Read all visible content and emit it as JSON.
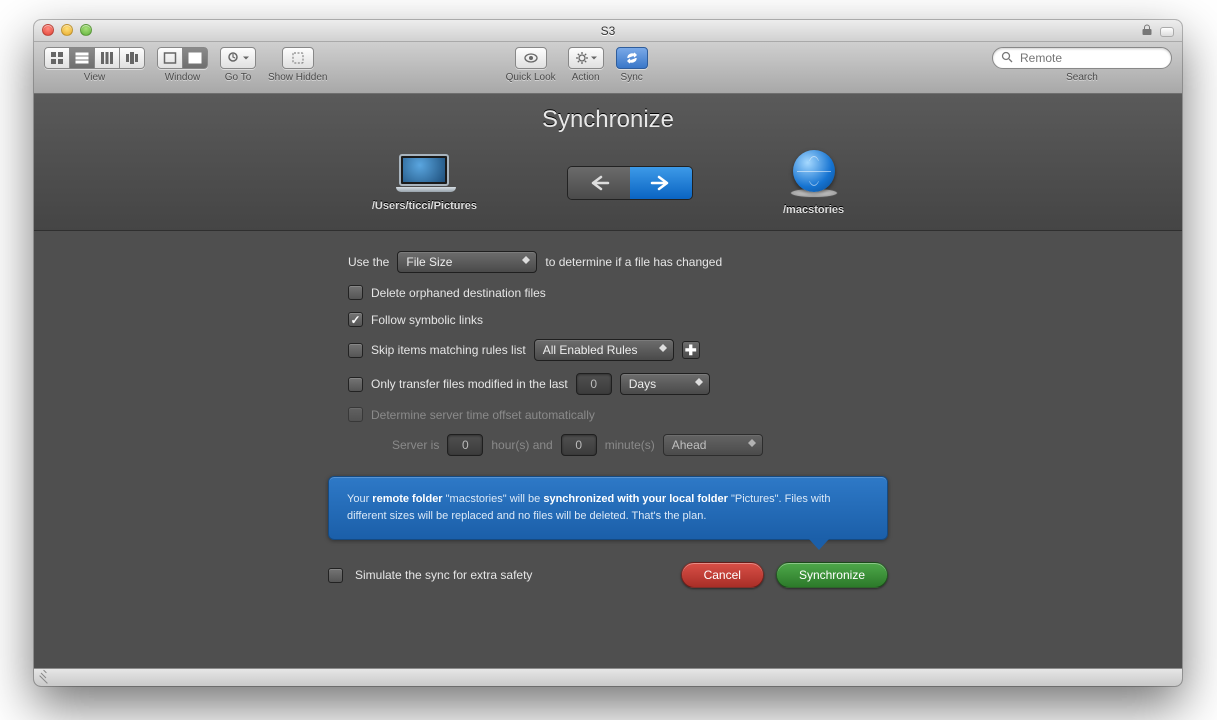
{
  "window": {
    "title": "S3"
  },
  "toolbar": {
    "view_label": "View",
    "window_label": "Window",
    "goto_label": "Go To",
    "show_hidden_label": "Show Hidden",
    "quick_look_label": "Quick Look",
    "action_label": "Action",
    "sync_label": "Sync",
    "search_label": "Search",
    "search_placeholder": "Remote"
  },
  "sync": {
    "title": "Synchronize",
    "local_path": "/Users/ticci/Pictures",
    "remote_path": "/macstories",
    "use_the_prefix": "Use the",
    "compare_method": "File Size",
    "use_the_suffix": "to determine if a file has changed",
    "delete_orphaned_label": "Delete orphaned destination files",
    "delete_orphaned_checked": false,
    "follow_symlinks_label": "Follow symbolic links",
    "follow_symlinks_checked": true,
    "skip_rules_label": "Skip items matching rules list",
    "skip_rules_checked": false,
    "rules_dropdown": "All Enabled Rules",
    "only_transfer_label": "Only transfer files modified in the last",
    "only_transfer_checked": false,
    "only_transfer_value": "0",
    "only_transfer_unit": "Days",
    "server_offset_label": "Determine server time offset automatically",
    "server_offset_checked": false,
    "server_is_prefix": "Server is",
    "server_hours": "0",
    "hours_label": "hour(s) and",
    "server_minutes": "0",
    "minutes_label": "minute(s)",
    "offset_direction": "Ahead"
  },
  "summary": {
    "t1": "Your ",
    "b1": "remote folder",
    "t2": " \"macstories\" will be ",
    "b2": "synchronized with your local folder",
    "t3": " \"Pictures\". Files with different sizes will be replaced and no files will be deleted. That's the plan."
  },
  "actions": {
    "simulate_label": "Simulate the sync for extra safety",
    "simulate_checked": false,
    "cancel": "Cancel",
    "synchronize": "Synchronize"
  }
}
